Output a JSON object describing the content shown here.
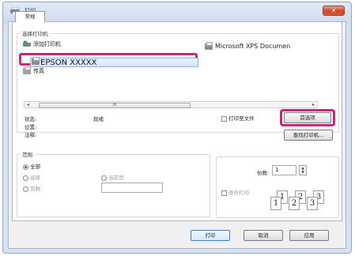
{
  "window": {
    "title": "打印",
    "close_symbol": "✕"
  },
  "tabs": [
    {
      "label": "常规"
    }
  ],
  "select_printer": {
    "group_label": "选择打印机",
    "printers": [
      {
        "label": "添加打印机",
        "icon": "add-printer-icon"
      },
      {
        "label": "Microsoft XPS Documen",
        "icon": "printer-icon"
      },
      {
        "label": "EPSON XXXXX",
        "icon": "printer-icon",
        "selected": true
      },
      {
        "label": "传真",
        "icon": "fax-icon"
      }
    ],
    "scrollbar_thumb": "III",
    "status_label": "状态:",
    "status_value": "就绪",
    "location_label": "位置:",
    "comment_label": "注释:",
    "print_to_file_label": "打印至文件",
    "preferences_button": "首选项",
    "find_printer_button": "查找打印机..."
  },
  "page_range": {
    "group_label": "范围",
    "options": [
      {
        "label": "全部",
        "checked": true
      },
      {
        "label": "选择",
        "checked": false
      },
      {
        "label": "当前页",
        "checked": false
      },
      {
        "label": "页数:",
        "checked": false
      }
    ],
    "pages_value": ""
  },
  "copies": {
    "label": "份数:",
    "value": "1",
    "collate_label": "逐份打印",
    "collate_pages": [
      "1",
      "2",
      "3"
    ]
  },
  "footer": {
    "print_button": "打印",
    "cancel_button": "取消",
    "apply_button": "应用"
  },
  "colors": {
    "highlight": "#c3287e",
    "selection": "#d7e6f8"
  }
}
